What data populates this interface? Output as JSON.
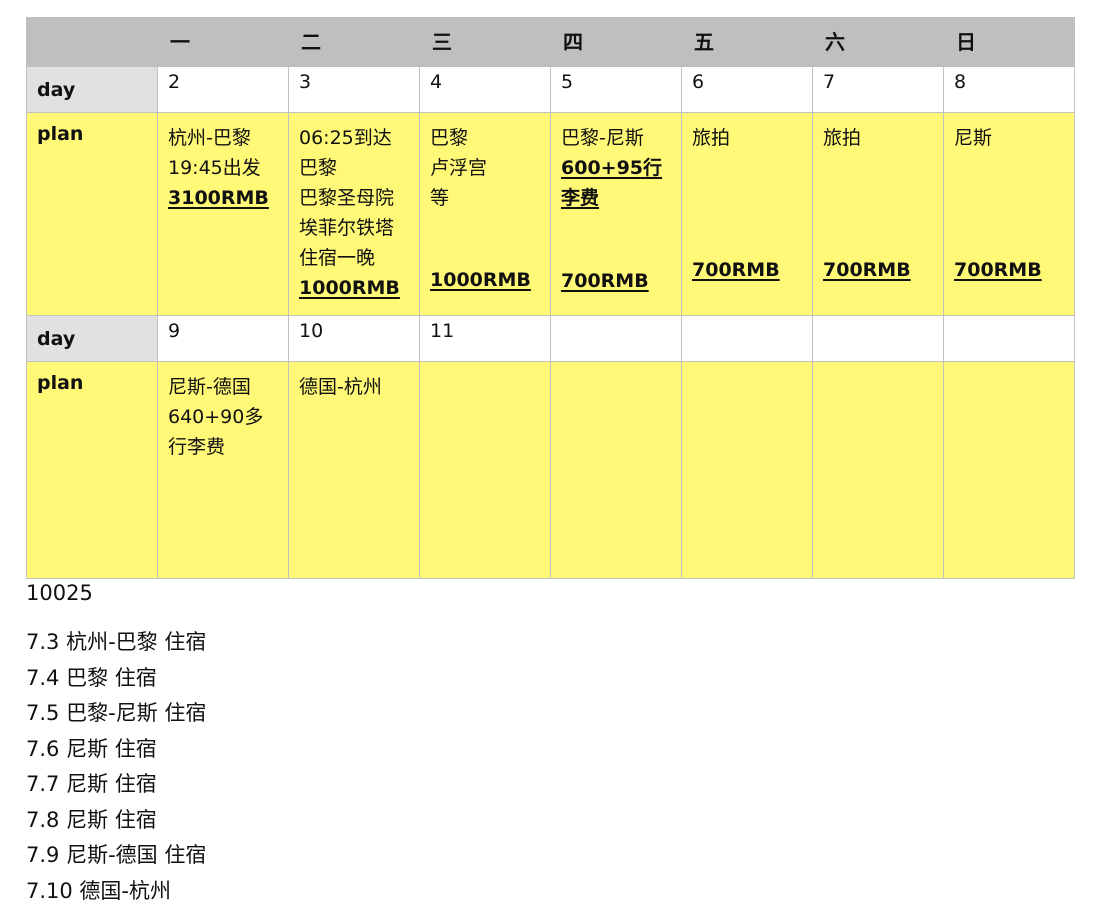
{
  "header": {
    "weekdays": [
      "一",
      "二",
      "三",
      "四",
      "五",
      "六",
      "日"
    ]
  },
  "labels": {
    "day": "day",
    "plan": "plan"
  },
  "week1": {
    "days": [
      "2",
      "3",
      "4",
      "5",
      "6",
      "7",
      "8"
    ],
    "plans": [
      {
        "lines": [
          "杭州-巴黎",
          "19:45出发"
        ],
        "price": "3100RMB"
      },
      {
        "lines": [
          "06:25到达",
          "巴黎",
          "巴黎圣母院",
          "埃菲尔铁塔",
          "住宿一晚"
        ],
        "price": "1000RMB"
      },
      {
        "lines": [
          "巴黎",
          "卢浮宫",
          "等"
        ],
        "price": "1000RMB"
      },
      {
        "lines": [
          "巴黎-尼斯"
        ],
        "extra1": "600+95行",
        "extra2": "李费",
        "price": "700RMB"
      },
      {
        "lines": [
          "旅拍"
        ],
        "price": "700RMB"
      },
      {
        "lines": [
          "旅拍"
        ],
        "price": "700RMB"
      },
      {
        "lines": [
          "尼斯"
        ],
        "price": "700RMB"
      }
    ]
  },
  "week2": {
    "days": [
      "9",
      "10",
      "11",
      "",
      "",
      "",
      ""
    ],
    "plans": [
      {
        "lines": [
          "尼斯-德国",
          "640+90多",
          "行李费"
        ]
      },
      {
        "lines": [
          "德国-杭州"
        ]
      },
      {
        "lines": []
      },
      {
        "lines": []
      },
      {
        "lines": []
      },
      {
        "lines": []
      },
      {
        "lines": []
      }
    ]
  },
  "code": "10025",
  "itinerary": [
    "7.3 杭州-巴黎 住宿",
    "7.4 巴黎 住宿",
    "7.5 巴黎-尼斯 住宿",
    "7.6 尼斯 住宿",
    "7.7 尼斯 住宿",
    "7.8 尼斯 住宿",
    "7.9 尼斯-德国 住宿",
    "7.10 德国-杭州"
  ]
}
